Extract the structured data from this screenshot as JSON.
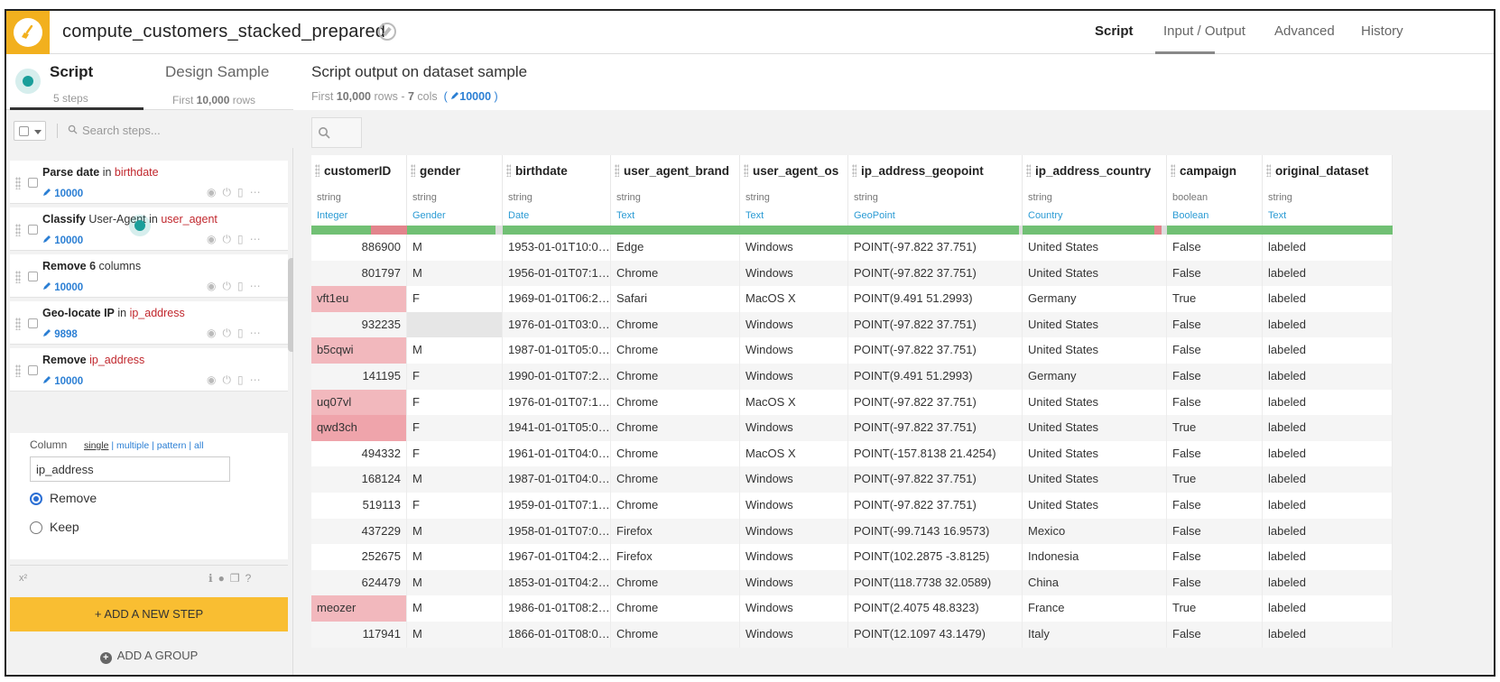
{
  "window": {
    "title": "compute_customers_stacked_prepared",
    "tabs": [
      "Script",
      "Input / Output",
      "Advanced",
      "History"
    ],
    "active_tab": "Script"
  },
  "left_tabs": {
    "script": {
      "label": "Script",
      "sub": "5 steps"
    },
    "design": {
      "label": "Design Sample",
      "sub_prefix": "First ",
      "sub_bold": "10,000",
      "sub_suffix": " rows"
    }
  },
  "search_steps": {
    "placeholder": "Search steps..."
  },
  "steps": [
    {
      "verb": "Parse date",
      "mid": " in ",
      "col": "birthdate",
      "count": "10000"
    },
    {
      "verb": "Classify",
      "mid": " User-Agent in ",
      "col": "user_agent",
      "count": "10000"
    },
    {
      "verb": "Remove",
      "mid": " 6 columns",
      "col": "",
      "count": "10000",
      "bold_mid": "6"
    },
    {
      "verb": "Geo-locate IP",
      "mid": " in ",
      "col": "ip_address",
      "count": "9898"
    },
    {
      "verb": "Remove",
      "mid": " ",
      "col": "ip_address",
      "count": "10000"
    }
  ],
  "step_options": {
    "column_label": "Column",
    "modes": [
      "single",
      "multiple",
      "pattern",
      "all"
    ],
    "column_value": "ip_address",
    "radio_remove": "Remove",
    "radio_keep": "Keep",
    "selected": "Remove"
  },
  "bottom_bar": {
    "x2": "x²"
  },
  "add_step_label": "+ ADD A NEW STEP",
  "add_group_label": "ADD A GROUP",
  "output": {
    "title": "Script output on dataset sample",
    "sub_prefix": "First ",
    "sub_rows": "10,000",
    "sub_mid": " rows - ",
    "sub_cols": "7",
    "sub_cols_suffix": " cols",
    "sub_count": "10000"
  },
  "columns": [
    {
      "name": "customerID",
      "storage": "string",
      "meaning": "Integer"
    },
    {
      "name": "gender",
      "storage": "string",
      "meaning": "Gender"
    },
    {
      "name": "birthdate",
      "storage": "string",
      "meaning": "Date"
    },
    {
      "name": "user_agent_brand",
      "storage": "string",
      "meaning": "Text"
    },
    {
      "name": "user_agent_os",
      "storage": "string",
      "meaning": "Text"
    },
    {
      "name": "ip_address_geopoint",
      "storage": "string",
      "meaning": "GeoPoint"
    },
    {
      "name": "ip_address_country",
      "storage": "string",
      "meaning": "Country"
    },
    {
      "name": "campaign",
      "storage": "boolean",
      "meaning": "Boolean"
    },
    {
      "name": "original_dataset",
      "storage": "string",
      "meaning": "Text"
    }
  ],
  "rows": [
    [
      "886900",
      "M",
      "1953-01-01T10:0…",
      "Edge",
      "Windows",
      "POINT(-97.822 37.751)",
      "United States",
      "False",
      "labeled"
    ],
    [
      "801797",
      "M",
      "1956-01-01T07:1…",
      "Chrome",
      "Windows",
      "POINT(-97.822 37.751)",
      "United States",
      "False",
      "labeled"
    ],
    [
      "vft1eu",
      "F",
      "1969-01-01T06:2…",
      "Safari",
      "MacOS X",
      "POINT(9.491 51.2993)",
      "Germany",
      "True",
      "labeled"
    ],
    [
      "932235",
      "",
      "1976-01-01T03:0…",
      "Chrome",
      "Windows",
      "POINT(-97.822 37.751)",
      "United States",
      "False",
      "labeled"
    ],
    [
      "b5cqwi",
      "M",
      "1987-01-01T05:0…",
      "Chrome",
      "Windows",
      "POINT(-97.822 37.751)",
      "United States",
      "False",
      "labeled"
    ],
    [
      "141195",
      "F",
      "1990-01-01T07:2…",
      "Chrome",
      "Windows",
      "POINT(9.491 51.2993)",
      "Germany",
      "False",
      "labeled"
    ],
    [
      "uq07vl",
      "F",
      "1976-01-01T07:1…",
      "Chrome",
      "MacOS X",
      "POINT(-97.822 37.751)",
      "United States",
      "False",
      "labeled"
    ],
    [
      "qwd3ch",
      "F",
      "1941-01-01T05:0…",
      "Chrome",
      "Windows",
      "POINT(-97.822 37.751)",
      "United States",
      "True",
      "labeled"
    ],
    [
      "494332",
      "F",
      "1961-01-01T04:0…",
      "Chrome",
      "MacOS X",
      "POINT(-157.8138 21.4254)",
      "United States",
      "False",
      "labeled"
    ],
    [
      "168124",
      "M",
      "1987-01-01T04:0…",
      "Chrome",
      "Windows",
      "POINT(-97.822 37.751)",
      "United States",
      "True",
      "labeled"
    ],
    [
      "519113",
      "F",
      "1959-01-01T07:1…",
      "Chrome",
      "Windows",
      "POINT(-97.822 37.751)",
      "United States",
      "False",
      "labeled"
    ],
    [
      "437229",
      "M",
      "1958-01-01T07:0…",
      "Firefox",
      "Windows",
      "POINT(-99.7143 16.9573)",
      "Mexico",
      "False",
      "labeled"
    ],
    [
      "252675",
      "M",
      "1967-01-01T04:2…",
      "Firefox",
      "Windows",
      "POINT(102.2875 -3.8125)",
      "Indonesia",
      "False",
      "labeled"
    ],
    [
      "624479",
      "M",
      "1853-01-01T04:2…",
      "Chrome",
      "Windows",
      "POINT(118.7738 32.0589)",
      "China",
      "False",
      "labeled"
    ],
    [
      "meozer",
      "M",
      "1986-01-01T08:2…",
      "Chrome",
      "Windows",
      "POINT(2.4075 48.8323)",
      "France",
      "True",
      "labeled"
    ],
    [
      "117941",
      "M",
      "1866-01-01T08:0…",
      "Chrome",
      "Windows",
      "POINT(12.1097 43.1479)",
      "Italy",
      "False",
      "labeled"
    ]
  ],
  "colors": {
    "accent": "#f2b01e",
    "valid": "#71c074",
    "invalid": "#e2848c",
    "empty": "#dddddd",
    "link": "#2b7fd4",
    "column_ref": "#c1272d"
  }
}
